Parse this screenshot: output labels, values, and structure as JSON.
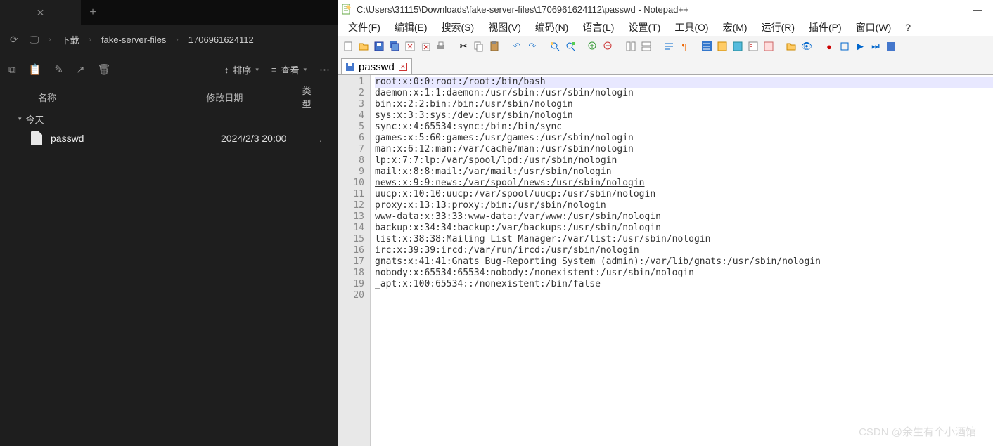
{
  "dark": {
    "new_tab": "+",
    "close": "✕",
    "breadcrumb": [
      "下载",
      "fake-server-files",
      "1706961624112"
    ],
    "sort": "排序",
    "view": "查看",
    "cols": {
      "name": "名称",
      "date": "修改日期",
      "type": "类型"
    },
    "section": "今天",
    "file": {
      "name": "passwd",
      "date": "2024/2/3 20:00",
      "type": "."
    }
  },
  "npp": {
    "title": "C:\\Users\\31115\\Downloads\\fake-server-files\\1706961624112\\passwd - Notepad++",
    "menus": [
      "文件(F)",
      "编辑(E)",
      "搜索(S)",
      "视图(V)",
      "编码(N)",
      "语言(L)",
      "设置(T)",
      "工具(O)",
      "宏(M)",
      "运行(R)",
      "插件(P)",
      "窗口(W)",
      "?"
    ],
    "tab": "passwd",
    "lines": [
      "root:x:0:0:root:/root:/bin/bash",
      "daemon:x:1:1:daemon:/usr/sbin:/usr/sbin/nologin",
      "bin:x:2:2:bin:/bin:/usr/sbin/nologin",
      "sys:x:3:3:sys:/dev:/usr/sbin/nologin",
      "sync:x:4:65534:sync:/bin:/bin/sync",
      "games:x:5:60:games:/usr/games:/usr/sbin/nologin",
      "man:x:6:12:man:/var/cache/man:/usr/sbin/nologin",
      "lp:x:7:7:lp:/var/spool/lpd:/usr/sbin/nologin",
      "mail:x:8:8:mail:/var/mail:/usr/sbin/nologin",
      "news:x:9:9:news:/var/spool/news:/usr/sbin/nologin",
      "uucp:x:10:10:uucp:/var/spool/uucp:/usr/sbin/nologin",
      "proxy:x:13:13:proxy:/bin:/usr/sbin/nologin",
      "www-data:x:33:33:www-data:/var/www:/usr/sbin/nologin",
      "backup:x:34:34:backup:/var/backups:/usr/sbin/nologin",
      "list:x:38:38:Mailing List Manager:/var/list:/usr/sbin/nologin",
      "irc:x:39:39:ircd:/var/run/ircd:/usr/sbin/nologin",
      "gnats:x:41:41:Gnats Bug-Reporting System (admin):/var/lib/gnats:/usr/sbin/nologin",
      "nobody:x:65534:65534:nobody:/nonexistent:/usr/sbin/nologin",
      "_apt:x:100:65534::/nonexistent:/bin/false",
      ""
    ]
  },
  "watermark": "CSDN @余生有个小酒馆"
}
